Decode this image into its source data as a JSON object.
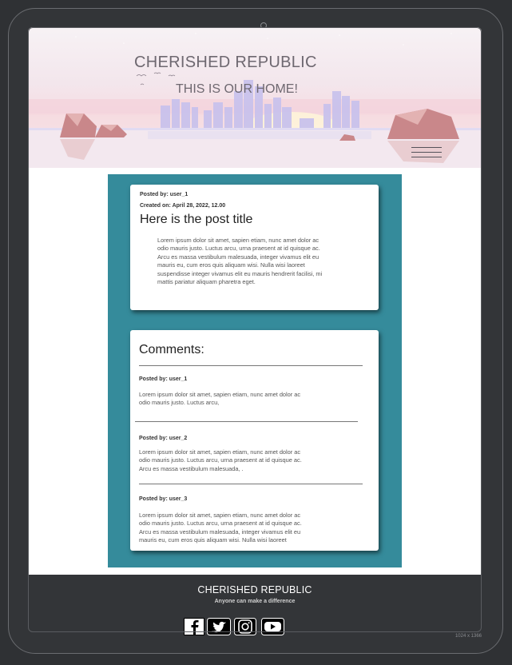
{
  "site": {
    "brand": "CHERISHED REPUBLIC",
    "tagline": "THIS IS OUR HOME!",
    "menu_icon": "hamburger-menu-icon"
  },
  "post": {
    "posted_by": "Posted by: user_1",
    "created_on": "Created on: April 28, 2022, 12.00",
    "title": "Here is the post title",
    "body": "Lorem ipsum dolor sit amet, sapien etiam, nunc amet dolor ac odio mauris justo. Luctus arcu, urna praesent at id quisque ac. Arcu es massa vestibulum malesuada, integer vivamus elit eu mauris eu, cum eros quis aliquam wisi. Nulla wisi laoreet suspendisse integer vivamus elit eu mauris hendrerit facilisi, mi mattis pariatur aliquam pharetra eget."
  },
  "comments": {
    "heading": "Comments:",
    "items": [
      {
        "author": "Posted by: user_1",
        "body": "Lorem ipsum dolor sit amet, sapien etiam, nunc amet dolor ac odio mauris justo. Luctus arcu,"
      },
      {
        "author": "Posted by: user_2",
        "body": "Lorem ipsum dolor sit amet, sapien etiam, nunc amet dolor ac odio mauris justo. Luctus arcu, urna praesent at id quisque ac. Arcu es massa vestibulum malesuada, ."
      },
      {
        "author": "Posted by: user_3",
        "body": "Lorem ipsum dolor sit amet, sapien etiam, nunc amet dolor ac odio mauris justo. Luctus arcu, urna praesent at id quisque ac. Arcu es massa vestibulum malesuada, integer vivamus elit eu mauris eu, cum eros quis aliquam wisi. Nulla wisi laoreet"
      }
    ]
  },
  "footer": {
    "title": "CHERISHED REPUBLIC",
    "slogan": "Anyone can make a difference",
    "social": [
      {
        "name": "facebook-icon"
      },
      {
        "name": "twitter-icon"
      },
      {
        "name": "instagram-icon"
      },
      {
        "name": "youtube-icon"
      }
    ]
  },
  "device": {
    "resolution_label": "1024 x 1366"
  },
  "colors": {
    "content_background": "#358b9b",
    "footer_background": "#333538",
    "card_background": "#ffffff"
  }
}
